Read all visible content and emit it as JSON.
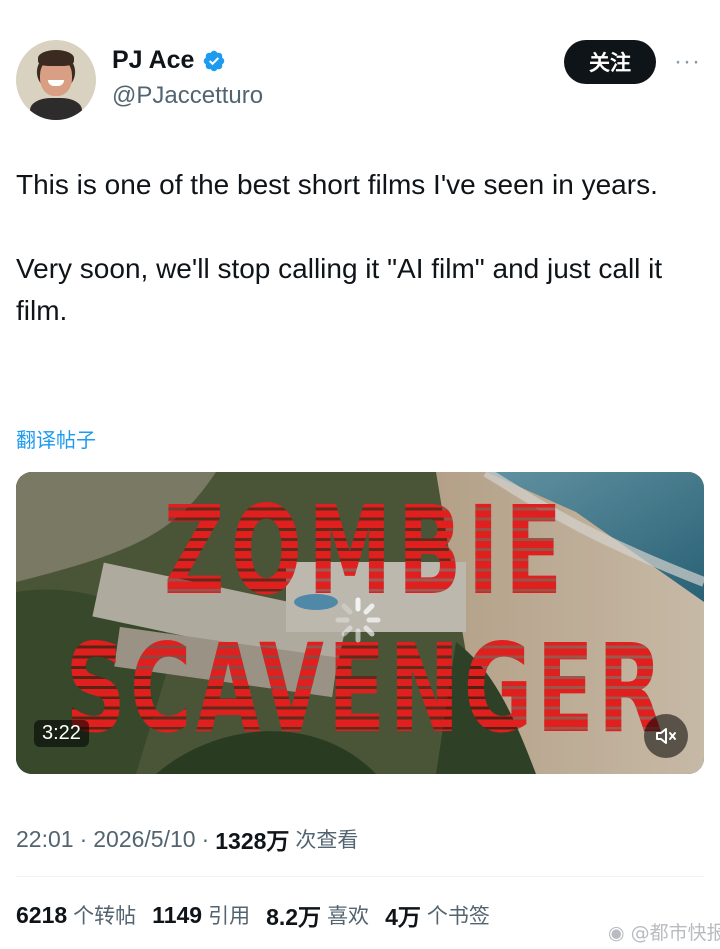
{
  "author": {
    "display_name": "PJ Ace",
    "handle": "@PJaccetturo",
    "verified_color": "#1d9bf0"
  },
  "follow_button": {
    "label": "关注"
  },
  "more_menu": {
    "icon": "more-horizontal-icon",
    "label": "···"
  },
  "tweet": {
    "paragraphs": [
      "This is one of the best short films I've seen in years.",
      "Very soon, we'll stop calling it \"AI film\" and just call it film."
    ]
  },
  "translate_link": {
    "label": "翻译帖子"
  },
  "media": {
    "title_line_1": "ZOMBIE",
    "title_line_2": "SCAVENGER",
    "duration": "3:22",
    "mute_icon": "speaker-muted-icon",
    "loading_icon": "spinner-icon"
  },
  "meta": {
    "time": "22:01",
    "date": "2026/5/10",
    "views_count": "1328万",
    "views_label": "次查看"
  },
  "stats": {
    "reposts_num": "6218",
    "reposts_label": "个转帖",
    "quotes_num": "1149",
    "quotes_label": "引用",
    "likes_num": "8.2万",
    "likes_label": "喜欢",
    "bookmarks_num": "4万",
    "bookmarks_label": "个书签"
  },
  "watermark": {
    "text": "@都市快报",
    "icon": "weibo-icon"
  },
  "colors": {
    "text_primary": "#0f1419",
    "text_secondary": "#536471",
    "link": "#1d9bf0",
    "title_red": "#d81c1c"
  }
}
